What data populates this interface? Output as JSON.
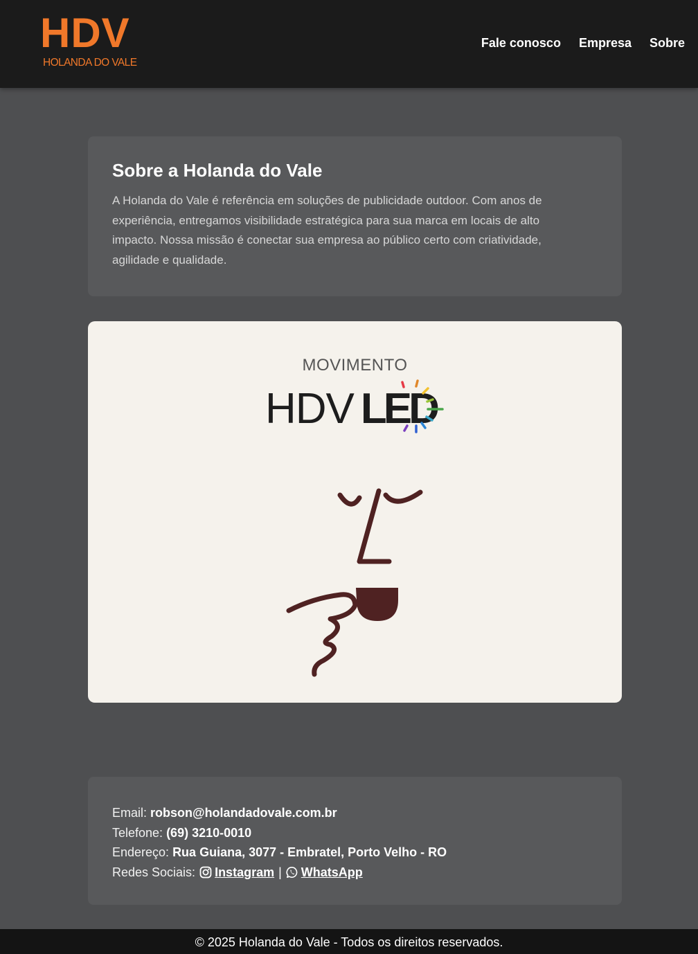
{
  "header": {
    "logo": {
      "mark": "HDV",
      "subtitle": "HOLANDA DO VALE"
    },
    "nav": [
      {
        "label": "Fale conosco"
      },
      {
        "label": "Empresa"
      },
      {
        "label": "Sobre"
      }
    ]
  },
  "about": {
    "title": "Sobre a Holanda do Vale",
    "body": "A Holanda do Vale é referência em soluções de publicidade outdoor. Com anos de experiência, entregamos visibilidade estratégica para sua marca em locais de alto impacto. Nossa missão é conectar sua empresa ao público certo com criatividade, agilidade e qualidade."
  },
  "banner": {
    "kicker": "MOVIMENTO",
    "brand_left": "HDV",
    "brand_right": "LED",
    "illustration": "person-drinking-coffee-icon"
  },
  "contact": {
    "email_label": "Email:",
    "email": "robson@holandadovale.com.br",
    "phone_label": "Telefone:",
    "phone": "(69) 3210-0010",
    "address_label": "Endereço:",
    "address": "Rua Guiana, 3077 - Embratel, Porto Velho - RO",
    "social_label": "Redes Sociais:",
    "instagram": "Instagram",
    "separator": "|",
    "whatsapp": "WhatsApp"
  },
  "footer": {
    "copyright": "© 2025 Holanda do Vale - Todos os direitos reservados."
  },
  "colors": {
    "brand_orange": "#f0782a",
    "header_bg": "#1b1b1b",
    "page_bg": "#4e4f51",
    "card_bg": "#58595b",
    "banner_bg": "#f5f2ec",
    "illustration": "#4f2222"
  }
}
